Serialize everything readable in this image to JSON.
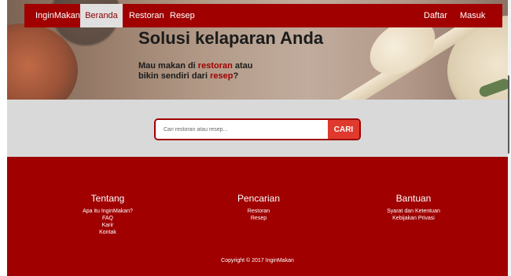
{
  "navbar": {
    "brand": "InginMakan",
    "items": [
      "Beranda",
      "Restoran",
      "Resep"
    ],
    "active": "Beranda",
    "right_items": [
      "Daftar",
      "Masuk"
    ]
  },
  "hero": {
    "title": "Solusi kelaparan Anda",
    "subtitle_line1_prefix": "Mau makan di ",
    "subtitle_line1_link": "restoran",
    "subtitle_line1_suffix": " atau",
    "subtitle_line2_prefix": "bikin sendiri dari ",
    "subtitle_line2_link": "resep",
    "subtitle_line2_suffix": "?"
  },
  "search": {
    "placeholder": "Cari restoran atau resep...",
    "button_label": "CARI"
  },
  "footer": {
    "columns": [
      {
        "title": "Tentang",
        "links": [
          "Apa itu InginMakan?",
          "FAQ",
          "Karir",
          "Kontak"
        ]
      },
      {
        "title": "Pencarian",
        "links": [
          "Restoran",
          "Resep"
        ]
      },
      {
        "title": "Bantuan",
        "links": [
          "Syarat dan Ketentuan",
          "Kebijakan Privasi"
        ]
      }
    ],
    "copyright": "Copyright © 2017 InginMakan"
  },
  "colors": {
    "brand_red": "#a00000",
    "button_red": "#e03a2e",
    "search_band": "#d9d9d9"
  }
}
